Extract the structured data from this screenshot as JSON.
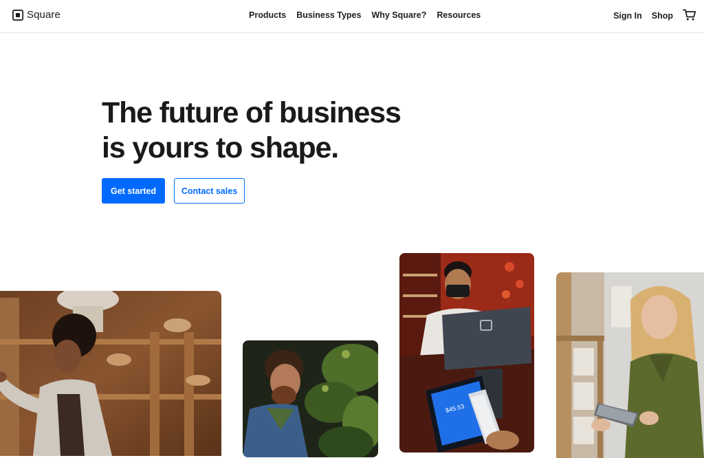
{
  "header": {
    "brand": "Square",
    "nav": [
      "Products",
      "Business Types",
      "Why Square?",
      "Resources"
    ],
    "sign_in": "Sign In",
    "shop": "Shop",
    "cart_icon": "cart-icon"
  },
  "hero": {
    "headline_line1": "The future of business",
    "headline_line2": "is yours to shape.",
    "primary_cta": "Get started",
    "secondary_cta": "Contact sales"
  },
  "terminal": {
    "amount": "$45.53"
  },
  "colors": {
    "accent": "#006aff",
    "text": "#1a1a1a",
    "background": "#ffffff"
  }
}
